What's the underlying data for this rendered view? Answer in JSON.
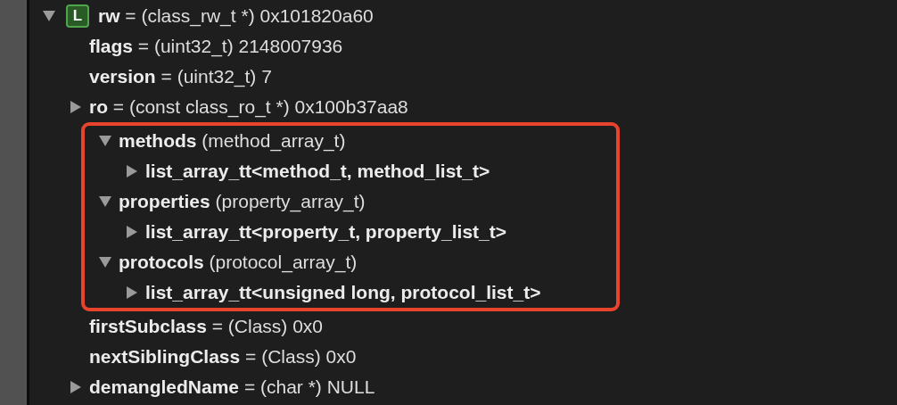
{
  "variables": [
    {
      "name": "rw",
      "detail": "= (class_rw_t *) 0x101820a60",
      "badge": "L",
      "expanded": true,
      "children": [
        {
          "name": "flags",
          "detail": "= (uint32_t) 2148007936"
        },
        {
          "name": "version",
          "detail": "= (uint32_t) 7"
        },
        {
          "name": "ro",
          "detail": "= (const class_ro_t *) 0x100b37aa8",
          "expanded": false
        },
        {
          "name": "methods",
          "detail": "(method_array_t)",
          "expanded": true,
          "highlighted": true,
          "children": [
            {
              "name": "list_array_tt<method_t, method_list_t>",
              "expanded": false
            }
          ]
        },
        {
          "name": "properties",
          "detail": "(property_array_t)",
          "expanded": true,
          "highlighted": true,
          "children": [
            {
              "name": "list_array_tt<property_t, property_list_t>",
              "expanded": false
            }
          ]
        },
        {
          "name": "protocols",
          "detail": "(protocol_array_t)",
          "expanded": true,
          "highlighted": true,
          "children": [
            {
              "name": "list_array_tt<unsigned long, protocol_list_t>",
              "expanded": false
            }
          ]
        },
        {
          "name": "firstSubclass",
          "detail": "= (Class) 0x0"
        },
        {
          "name": "nextSiblingClass",
          "detail": "= (Class) 0x0"
        },
        {
          "name": "demangledName",
          "detail": "= (char *) NULL",
          "expanded": false
        }
      ]
    }
  ]
}
